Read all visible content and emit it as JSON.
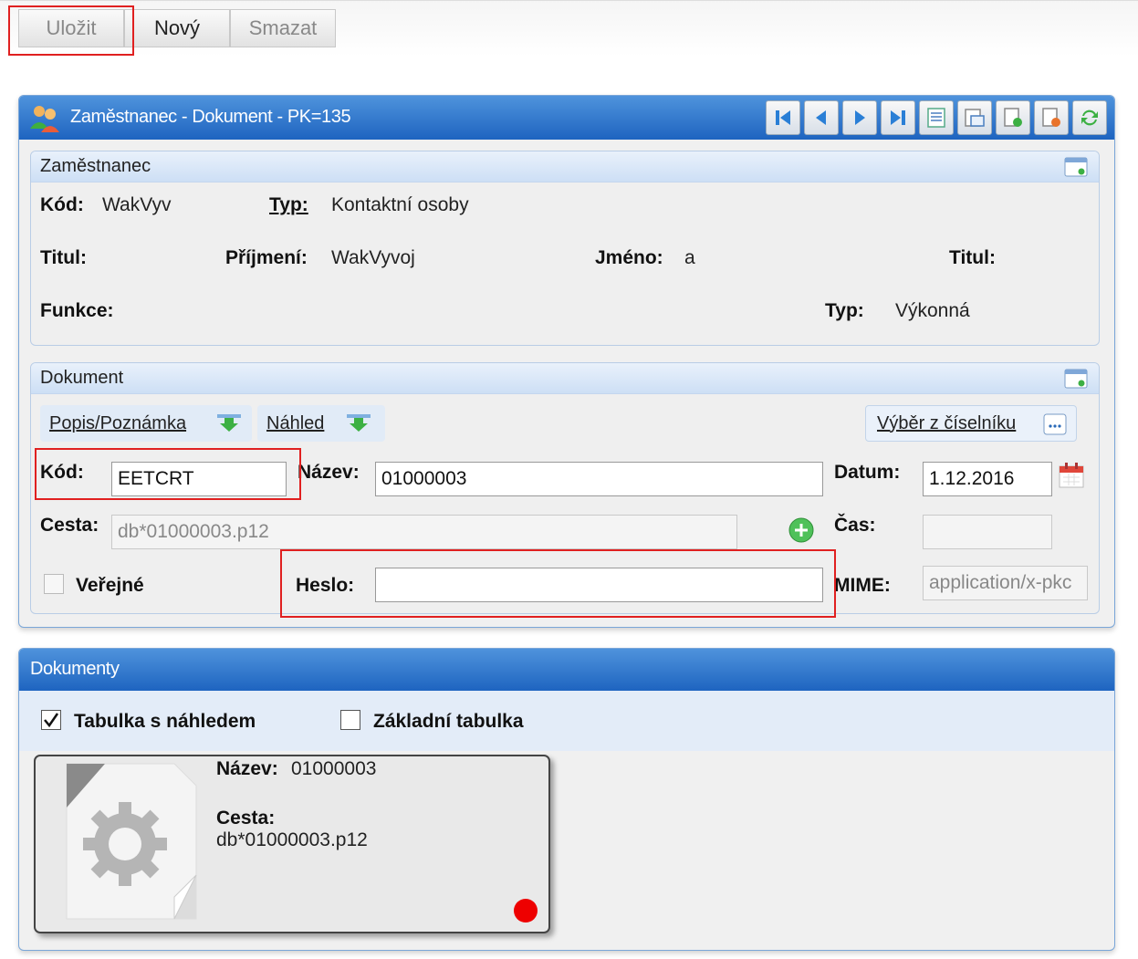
{
  "toolbar": {
    "save_label": "Uložit",
    "new_label": "Nový",
    "delete_label": "Smazat"
  },
  "window": {
    "title": "Zaměstnanec - Dokument - PK=135"
  },
  "employee": {
    "section_title": "Zaměstnanec",
    "code_label": "Kód:",
    "code_value": "WakVyv",
    "type_label": "Typ:",
    "type_value": "Kontaktní osoby",
    "title_label": "Titul:",
    "surname_label": "Příjmení:",
    "surname_value": "WakVyvoj",
    "firstname_label": "Jméno:",
    "firstname_value": "a",
    "title2_label": "Titul:",
    "function_label": "Funkce:",
    "type2_label": "Typ:",
    "type2_value": "Výkonná"
  },
  "document": {
    "section_title": "Dokument",
    "tab_note": "Popis/Poznámka",
    "tab_preview": "Náhled",
    "catalog_button": "Výběr z číselníku",
    "code_label": "Kód:",
    "code_value": "EETCRT",
    "name_label": "Název:",
    "name_value": "01000003",
    "date_label": "Datum:",
    "date_value": "1.12.2016",
    "path_label": "Cesta:",
    "path_value": "db*01000003.p12",
    "time_label": "Čas:",
    "time_value": "",
    "public_label": "Veřejné",
    "password_label": "Heslo:",
    "password_value": "",
    "mime_label": "MIME:",
    "mime_value": "application/x-pkc"
  },
  "documents": {
    "title": "Dokumenty",
    "view_preview_label": "Tabulka s náhledem",
    "view_basic_label": "Základní tabulka",
    "card": {
      "name_label": "Název:",
      "name_value": "01000003",
      "path_label": "Cesta:",
      "path_value": "db*01000003.p12",
      "status_color": "#ee0000"
    }
  }
}
